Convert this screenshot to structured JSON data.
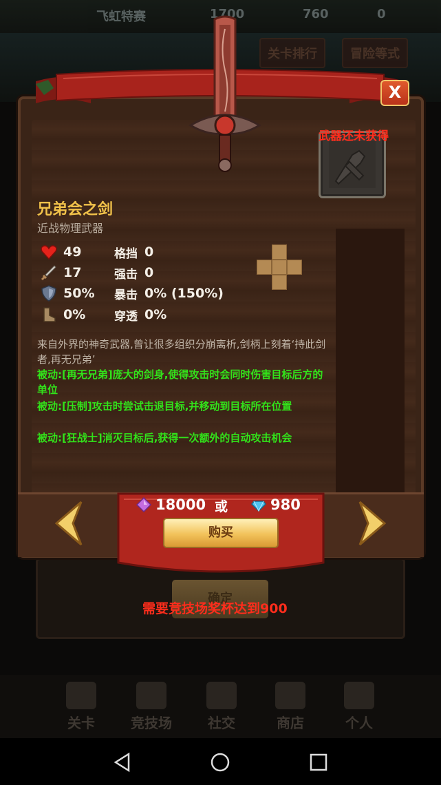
{
  "background": {
    "top_bar": {
      "title": "飞虹特赛",
      "gold": "1700",
      "crystal": "760",
      "gem": "0"
    },
    "tabs": [
      "关卡排行",
      "冒险等式"
    ],
    "confirm_label": "确定",
    "bottom_nav": [
      "关卡",
      "竞技场",
      "社交",
      "商店",
      "个人"
    ]
  },
  "dialog": {
    "status": "武器还未获得",
    "weapon_name": "兄弟会之剑",
    "weapon_type": "近战物理武器",
    "stats_left": [
      {
        "icon": "heart-icon",
        "value": "49"
      },
      {
        "icon": "sword-icon",
        "value": "17"
      },
      {
        "icon": "shield-icon",
        "value": "50%"
      },
      {
        "icon": "boot-icon",
        "value": "0%"
      }
    ],
    "stats_right": [
      {
        "label": "格挡",
        "value": "0"
      },
      {
        "label": "强击",
        "value": "0"
      },
      {
        "label": "暴击",
        "value": "0% (150%)"
      },
      {
        "label": "穿透",
        "value": "0%"
      }
    ],
    "description": "来自外界的神奇武器,曾让很多组织分崩离析,剑柄上刻着‘持此剑者,再无兄弟’",
    "passives": [
      "被动:[再无兄弟]庞大的剑身,使得攻击时会同时伤害目标后方的单位",
      "被动:[压制]攻击时尝试击退目标,并移动到目标所在位置",
      "被动:[狂战士]消灭目标后,获得一次额外的自动攻击机会"
    ],
    "price_crystal": "18000",
    "price_or": "或",
    "price_diamond": "980",
    "buy_label": "购买",
    "close_label": "X",
    "requirement": "需要竞技场奖杯达到900"
  },
  "colors": {
    "title_gold": "#f1c24a",
    "passive_green": "#32e21a",
    "warning_red": "#ff2d1c",
    "banner_red": "#a8231c"
  }
}
